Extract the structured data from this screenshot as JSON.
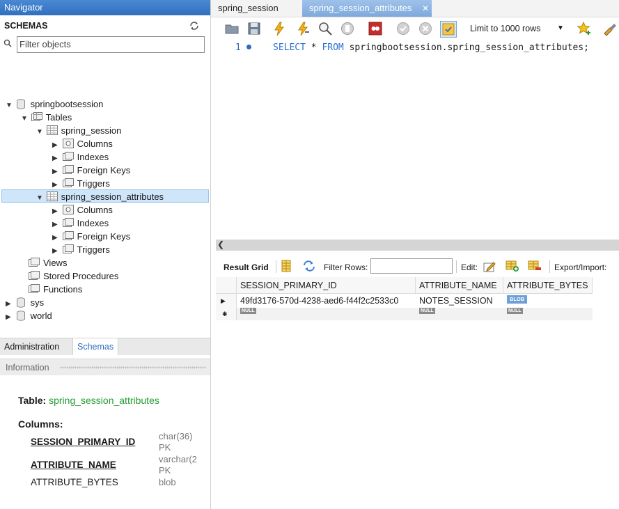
{
  "navigator": {
    "title": "Navigator",
    "schemas_label": "SCHEMAS",
    "filter_placeholder": "Filter objects",
    "tree": {
      "db1": "springbootsession",
      "tables": "Tables",
      "t1": "spring_session",
      "t1_columns": "Columns",
      "t1_indexes": "Indexes",
      "t1_fkeys": "Foreign Keys",
      "t1_triggers": "Triggers",
      "t2": "spring_session_attributes",
      "t2_columns": "Columns",
      "t2_indexes": "Indexes",
      "t2_fkeys": "Foreign Keys",
      "t2_triggers": "Triggers",
      "views": "Views",
      "procs": "Stored Procedures",
      "functions": "Functions",
      "db2": "sys",
      "db3": "world"
    },
    "tabs": {
      "administration": "Administration",
      "schemas": "Schemas"
    },
    "info": {
      "header": "Information",
      "table_label": "Table:",
      "table_name": "spring_session_attributes",
      "columns_label": "Columns:",
      "columns": [
        {
          "name": "SESSION_PRIMARY_ID",
          "type": "char(36)",
          "key": "PK"
        },
        {
          "name": "ATTRIBUTE_NAME",
          "type": "varchar(2",
          "key": "PK"
        },
        {
          "name": "ATTRIBUTE_BYTES",
          "type": "blob",
          "key": ""
        }
      ]
    }
  },
  "doc_tabs": [
    "spring_session",
    "spring_session_attributes"
  ],
  "toolbar": {
    "limit": "Limit to 1000 rows"
  },
  "editor": {
    "line": "1",
    "kw_select": "SELECT",
    "star": " * ",
    "kw_from": "FROM",
    "rest": " springbootsession.spring_session_attributes;"
  },
  "results": {
    "result_grid": "Result Grid",
    "filter_rows": "Filter Rows:",
    "edit": "Edit:",
    "export": "Export/Import:",
    "columns": [
      "SESSION_PRIMARY_ID",
      "ATTRIBUTE_NAME",
      "ATTRIBUTE_BYTES"
    ],
    "row1": [
      "49fd3176-570d-4238-aed6-f44f2c2533c0",
      "NOTES_SESSION",
      "BLOB"
    ],
    "null_label": "NULL"
  },
  "colors": {
    "accent": "#2f6fbf",
    "table_name": "#239d33",
    "keyword": "#2c6fd1",
    "selection": "#cfe5fa"
  }
}
